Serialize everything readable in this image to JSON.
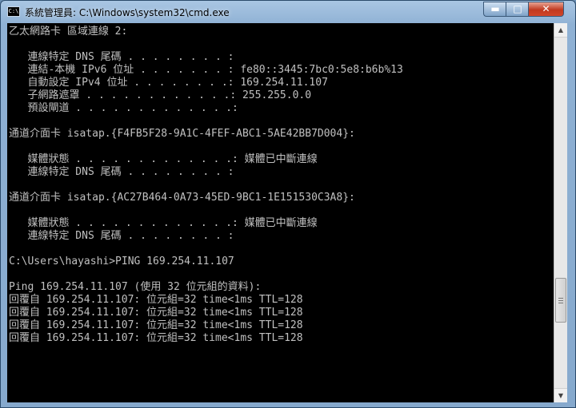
{
  "window": {
    "icon_label": "C:\\",
    "title": "系統管理員: C:\\Windows\\system32\\cmd.exe",
    "controls": {
      "minimize": "▬",
      "maximize": "□",
      "close": "✕"
    }
  },
  "console": {
    "lines": [
      "乙太網路卡 區域連線 2:",
      "",
      "   連線特定 DNS 尾碼 . . . . . . . . :",
      "   連結-本機 IPv6 位址 . . . . . . . : fe80::3445:7bc0:5e8:b6b%13",
      "   自動設定 IPv4 位址 . . . . . . . .: 169.254.11.107",
      "   子網路遮罩 . . . . . . . . . . . .: 255.255.0.0",
      "   預設閘道 . . . . . . . . . . . . .:",
      "",
      "通道介面卡 isatap.{F4FB5F28-9A1C-4FEF-ABC1-5AE42BB7D004}:",
      "",
      "   媒體狀態 . . . . . . . . . . . . .: 媒體已中斷連線",
      "   連線特定 DNS 尾碼 . . . . . . . . :",
      "",
      "通道介面卡 isatap.{AC27B464-0A73-45ED-9BC1-1E151530C3A8}:",
      "",
      "   媒體狀態 . . . . . . . . . . . . .: 媒體已中斷連線",
      "   連線特定 DNS 尾碼 . . . . . . . . :",
      "",
      "C:\\Users\\hayashi>PING 169.254.11.107",
      "",
      "Ping 169.254.11.107 (使用 32 位元組的資料):",
      "回覆自 169.254.11.107: 位元組=32 time<1ms TTL=128",
      "回覆自 169.254.11.107: 位元組=32 time<1ms TTL=128",
      "回覆自 169.254.11.107: 位元組=32 time<1ms TTL=128",
      "回覆自 169.254.11.107: 位元組=32 time<1ms TTL=128"
    ]
  },
  "scrollbar": {
    "up": "▲",
    "down": "▼"
  },
  "colors": {
    "console_bg": "#000000",
    "console_fg": "#c0c0c0",
    "close_button": "#c7432a"
  }
}
